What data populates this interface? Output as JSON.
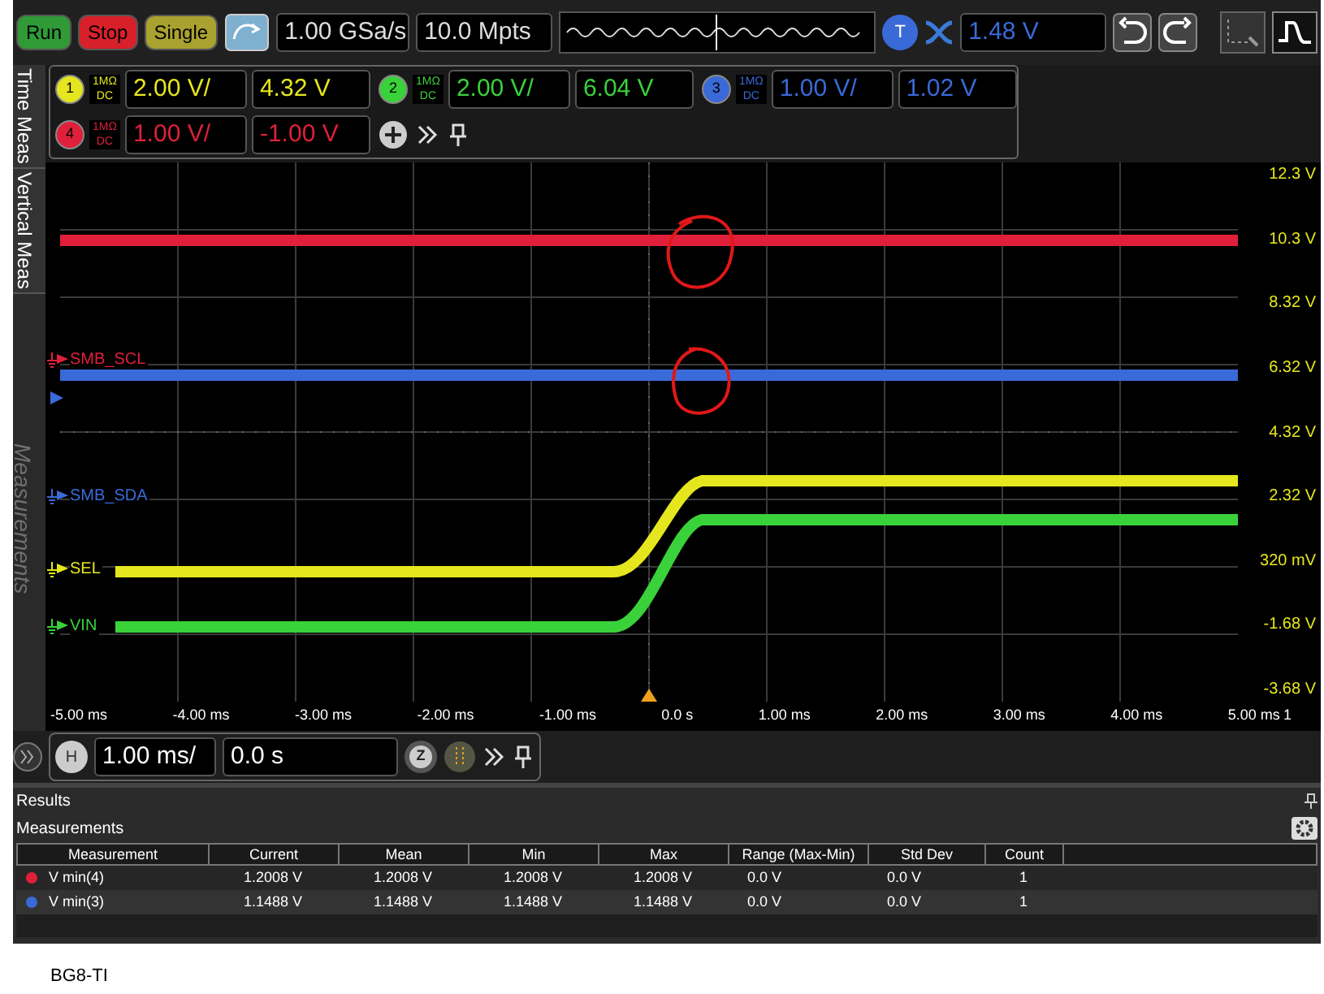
{
  "toolbar": {
    "run_buttons": [
      {
        "label": "Run",
        "color": "#2f9a36"
      },
      {
        "label": "Stop",
        "color": "#d8202a"
      },
      {
        "label": "Single",
        "color": "#aaa22e"
      }
    ],
    "sample_rate": "1.00 GSa/s",
    "memory_depth": "10.0 Mpts",
    "trigger": {
      "badge": "T",
      "level": "1.48 V"
    }
  },
  "side_tabs": [
    {
      "label": "Time Meas",
      "disabled": false
    },
    {
      "label": "Vertical Meas",
      "disabled": false
    },
    {
      "label": "Measurements",
      "disabled": true
    }
  ],
  "channels": [
    {
      "number": "1",
      "impedance": "1MΩ",
      "coupling": "DC",
      "scale": "2.00 V/",
      "offset": "4.32 V",
      "color": "#e6e61e"
    },
    {
      "number": "2",
      "impedance": "1MΩ",
      "coupling": "DC",
      "scale": "2.00 V/",
      "offset": "6.04 V",
      "color": "#3ad23a"
    },
    {
      "number": "3",
      "impedance": "1MΩ",
      "coupling": "DC",
      "scale": "1.00 V/",
      "offset": "1.02 V",
      "color": "#3a6ad8"
    },
    {
      "number": "4",
      "impedance": "1MΩ",
      "coupling": "DC",
      "scale": "1.00 V/",
      "offset": "-1.00 V",
      "color": "#e0203a"
    }
  ],
  "plot": {
    "trace_labels": [
      {
        "label": "SMB_SCL",
        "color": "#e0203a"
      },
      {
        "label": "SMB_SDA",
        "color": "#3a6ad8"
      },
      {
        "label": "SEL",
        "color": "#e6e61e"
      },
      {
        "label": "VIN",
        "color": "#3ad23a"
      }
    ],
    "y_labels": [
      "12.3 V",
      "10.3 V",
      "8.32 V",
      "6.32 V",
      "4.32 V",
      "2.32 V",
      "320 mV",
      "-1.68 V",
      "-3.68 V"
    ],
    "x_labels": [
      "-5.00 ms",
      "-4.00 ms",
      "-3.00 ms",
      "-2.00 ms",
      "-1.00 ms",
      "0.0 s",
      "1.00 ms",
      "2.00 ms",
      "3.00 ms",
      "4.00 ms",
      "5.00 ms"
    ],
    "edge_label": "1"
  },
  "horizontal": {
    "badge": "H",
    "scale": "1.00 ms/",
    "delay": "0.0 s",
    "zoom_badge": "Z"
  },
  "results": {
    "title": "Results",
    "section": "Measurements",
    "columns": [
      "Measurement",
      "Current",
      "Mean",
      "Min",
      "Max",
      "Range (Max-Min)",
      "Std Dev",
      "Count"
    ],
    "rows": [
      {
        "color": "#e0203a",
        "cells": [
          "V min(4)",
          "1.2008 V",
          "1.2008 V",
          "1.2008 V",
          "1.2008 V",
          "0.0 V",
          "0.0 V",
          "1"
        ]
      },
      {
        "color": "#3a6ad8",
        "cells": [
          "V min(3)",
          "1.1488 V",
          "1.1488 V",
          "1.1488 V",
          "1.1488 V",
          "0.0 V",
          "0.0 V",
          "1"
        ]
      }
    ]
  },
  "caption": "BG8-TI"
}
